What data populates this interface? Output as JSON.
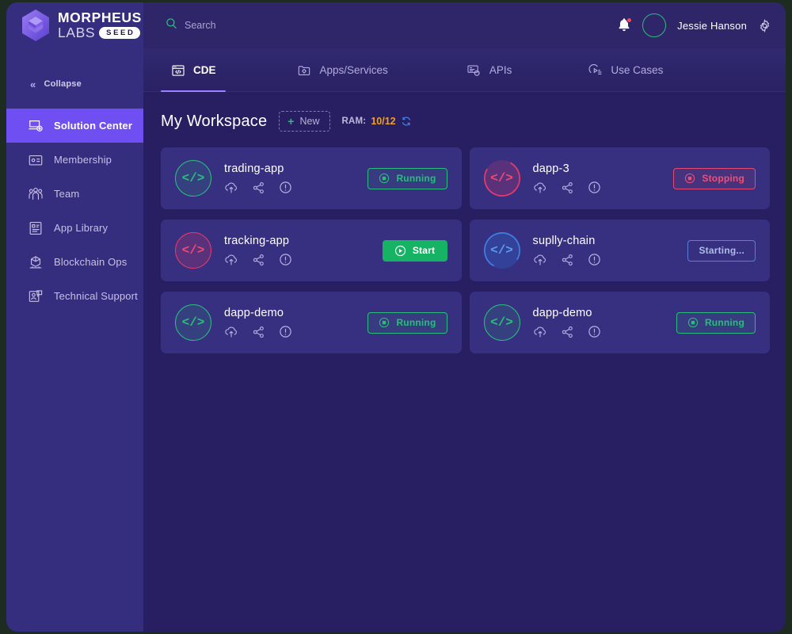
{
  "brand": {
    "line1": "MORPHEUS",
    "line2": "LABS",
    "badge": "SEED",
    "logo_icon": "hexagon-cube-logo"
  },
  "search": {
    "placeholder": "Search",
    "value": "",
    "icon": "search-icon"
  },
  "topbar": {
    "notifications_icon": "bell-icon",
    "has_unread": true,
    "avatar_icon": "avatar",
    "username": "Jessie Hanson",
    "settings_icon": "gear-icon"
  },
  "sidebar": {
    "collapse_label": "Collapse",
    "collapse_icon": "chevron-double-left-icon",
    "items": [
      {
        "label": "Solution Center",
        "icon": "solution-center-icon",
        "active": true
      },
      {
        "label": "Membership",
        "icon": "membership-card-icon",
        "active": false
      },
      {
        "label": "Team",
        "icon": "team-people-icon",
        "active": false
      },
      {
        "label": "App Library",
        "icon": "app-library-icon",
        "active": false
      },
      {
        "label": "Blockchain Ops",
        "icon": "blockchain-cube-icon",
        "active": false
      },
      {
        "label": "Technical Support",
        "icon": "support-agent-icon",
        "active": false
      }
    ]
  },
  "tabs": [
    {
      "label": "CDE",
      "icon": "browser-code-icon",
      "active": true
    },
    {
      "label": "Apps/Services",
      "icon": "folder-gear-icon",
      "active": false
    },
    {
      "label": "APIs",
      "icon": "api-gear-icon",
      "active": false
    },
    {
      "label": "Use Cases",
      "icon": "play-list-icon",
      "active": false
    }
  ],
  "workspace": {
    "title": "My Workspace",
    "new_button": {
      "label": "New",
      "plus": "+"
    },
    "ram_label": "RAM:",
    "ram_value": "10/12",
    "refresh_icon": "refresh-icon"
  },
  "cards": [
    {
      "title": "trading-app",
      "avatar_color": "green",
      "avatar_glyph": "</>",
      "spinner": false,
      "actions": [
        "cloud-upload-icon",
        "share-nodes-icon",
        "info-circle-icon"
      ],
      "status": {
        "label": "Running",
        "style": "running",
        "icon": "stop-square-icon"
      }
    },
    {
      "title": "dapp-3",
      "avatar_color": "pink",
      "avatar_glyph": "</>",
      "spinner": true,
      "actions": [
        "cloud-upload-icon",
        "share-nodes-icon",
        "info-circle-icon"
      ],
      "status": {
        "label": "Stopping",
        "style": "stopping",
        "icon": "stop-square-icon"
      }
    },
    {
      "title": "tracking-app",
      "avatar_color": "pink",
      "avatar_glyph": "</>",
      "spinner": false,
      "actions": [
        "cloud-upload-icon",
        "share-nodes-icon",
        "info-circle-icon"
      ],
      "status": {
        "label": "Start",
        "style": "start",
        "icon": "play-circle-icon"
      }
    },
    {
      "title": "suplly-chain",
      "avatar_color": "blue",
      "avatar_glyph": "</>",
      "spinner": true,
      "actions": [
        "cloud-upload-icon",
        "share-nodes-icon",
        "info-circle-icon"
      ],
      "status": {
        "label": "Starting...",
        "style": "starting",
        "icon": ""
      }
    },
    {
      "title": "dapp-demo",
      "avatar_color": "green",
      "avatar_glyph": "</>",
      "spinner": false,
      "actions": [
        "cloud-upload-icon",
        "share-nodes-icon",
        "info-circle-icon"
      ],
      "status": {
        "label": "Running",
        "style": "running",
        "icon": "stop-square-icon"
      }
    },
    {
      "title": "dapp-demo",
      "avatar_color": "green",
      "avatar_glyph": "</>",
      "spinner": false,
      "actions": [
        "cloud-upload-icon",
        "share-nodes-icon",
        "info-circle-icon"
      ],
      "status": {
        "label": "Running",
        "style": "running",
        "icon": "stop-square-icon"
      }
    }
  ],
  "colors": {
    "app_background": "#281f63",
    "sidebar": "#352d7e",
    "card": "#373080",
    "accent_purple": "#6f4ff2",
    "tab_underline": "#9b7dff",
    "green": "#2bbd7e",
    "start_green": "#16b364",
    "pink": "#ee4f77",
    "blue": "#5b9cf0",
    "ram_orange": "#f0a027",
    "notification_red": "#f6465d"
  }
}
